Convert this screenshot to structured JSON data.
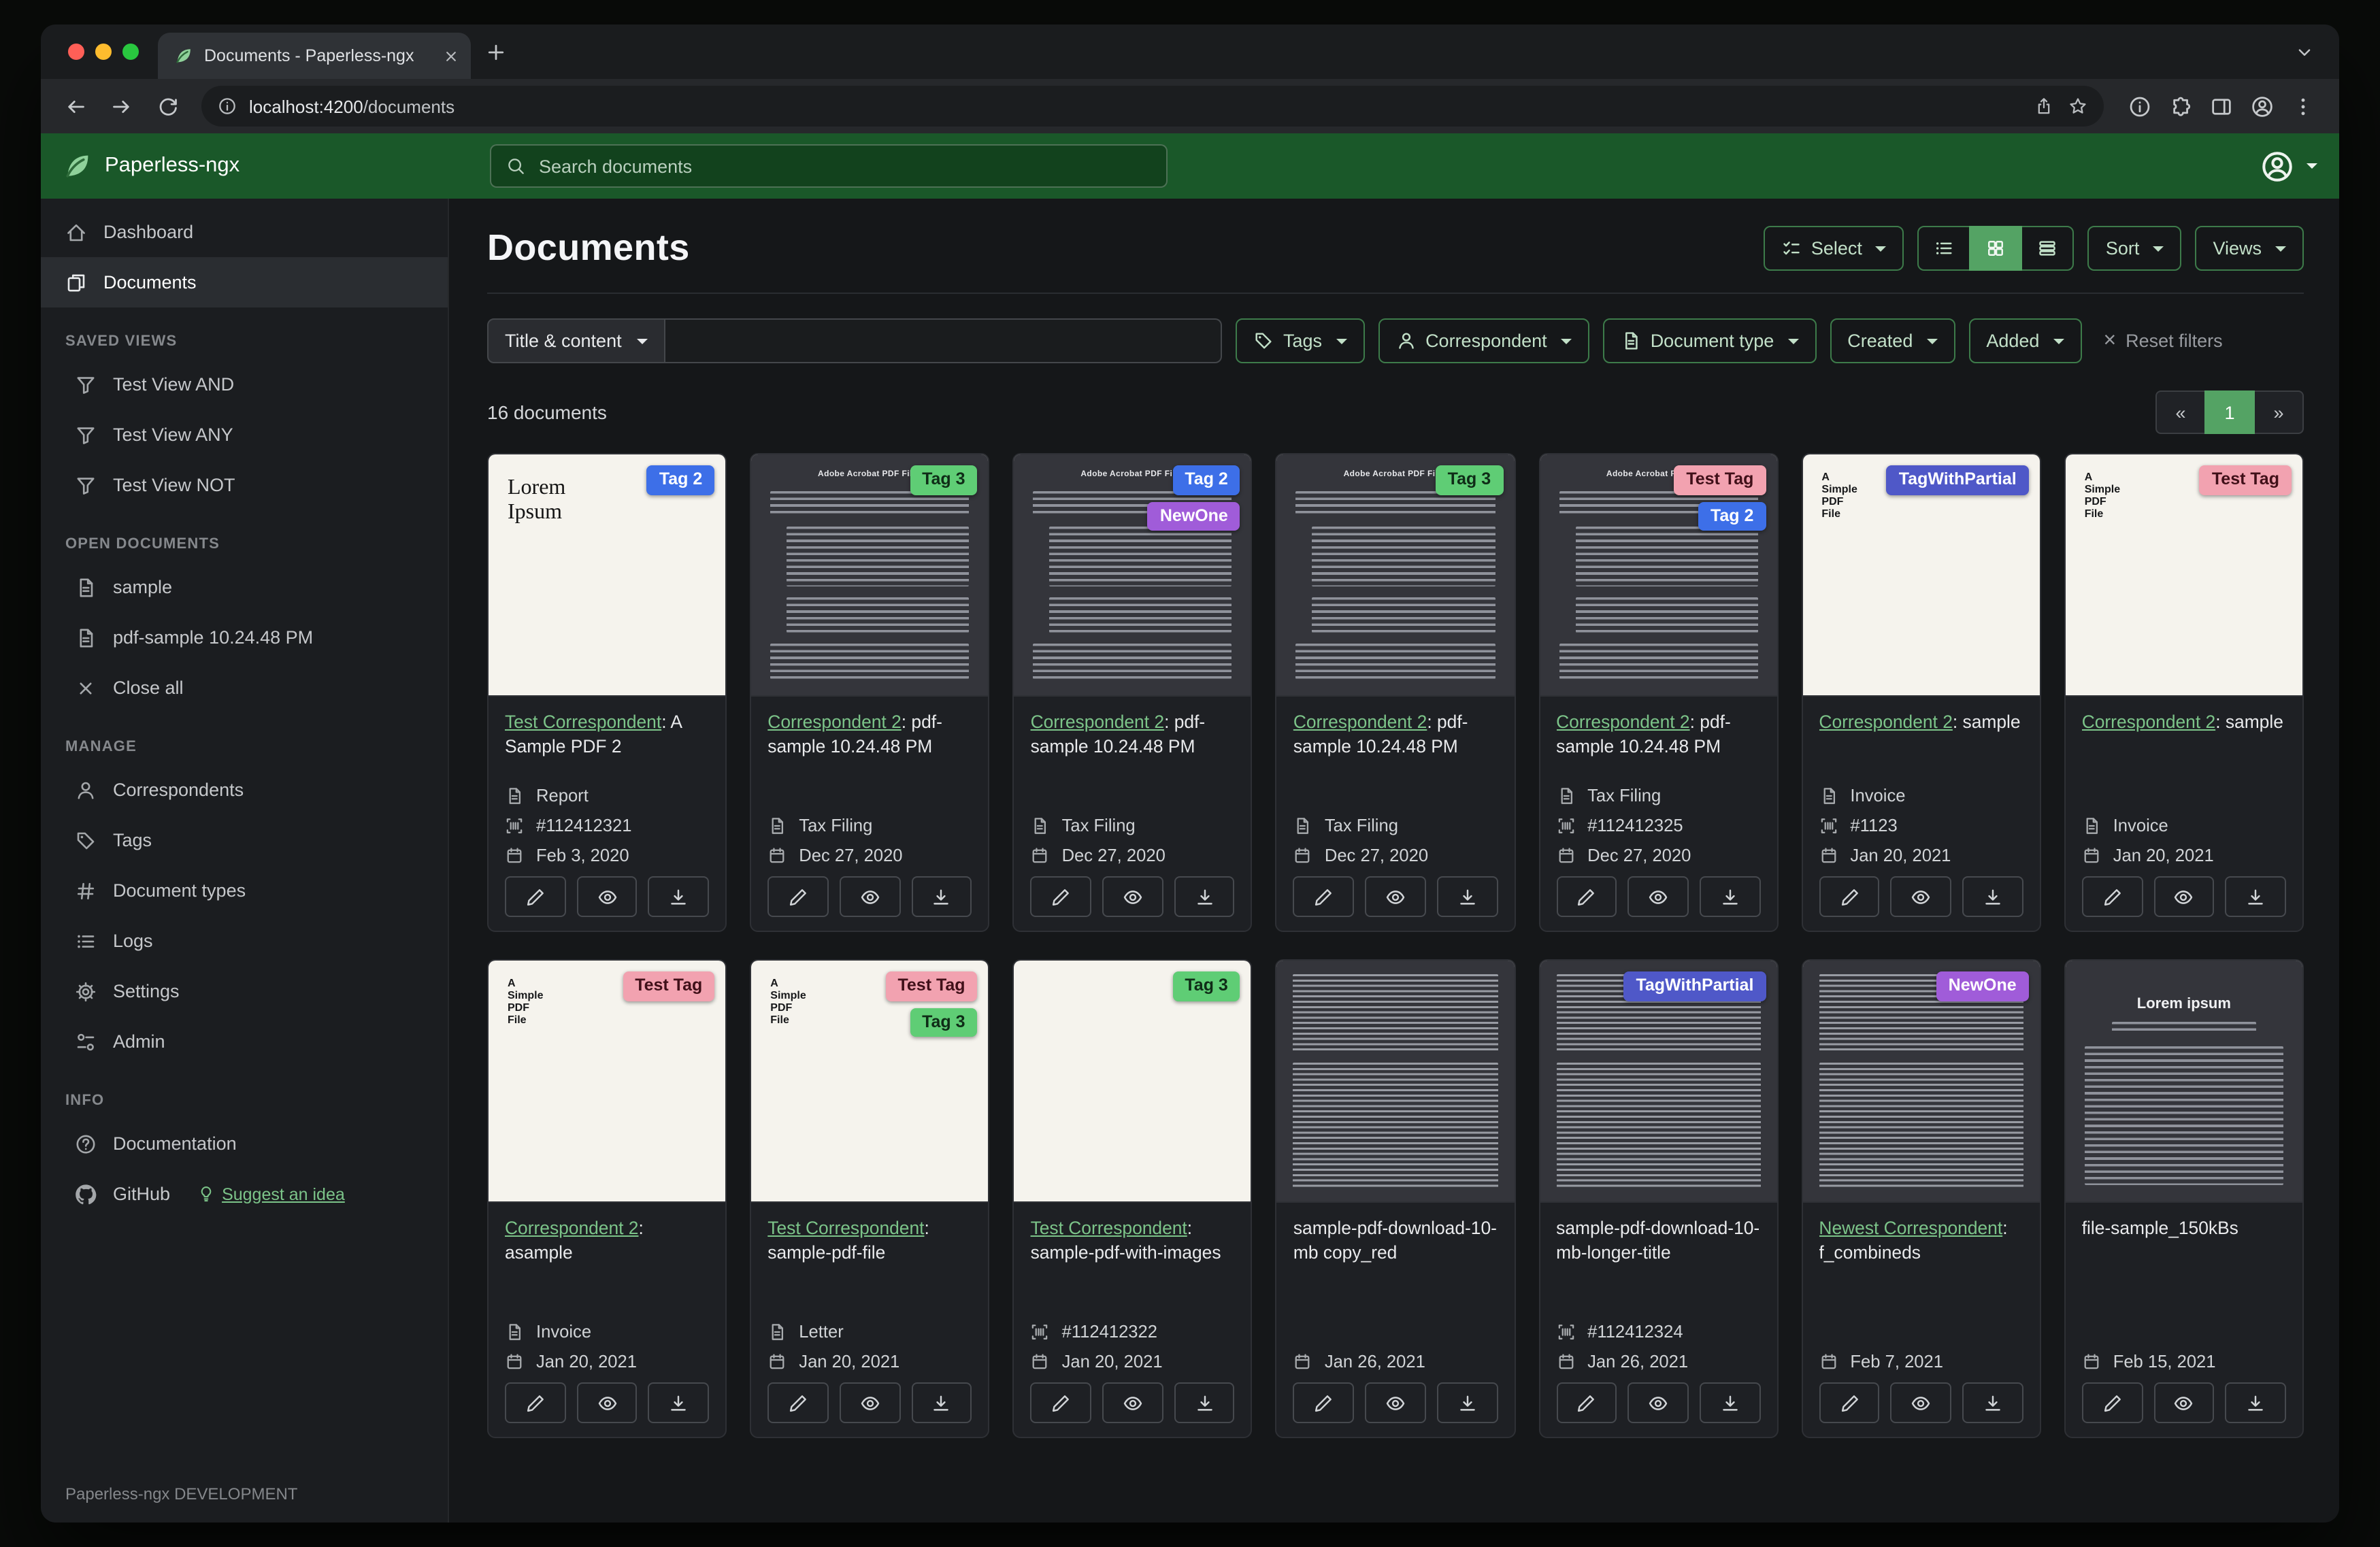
{
  "colors": {
    "header_green": "#1a5829",
    "accent_green": "#54a364",
    "link_green": "#7cc489"
  },
  "browser": {
    "tab_title": "Documents - Paperless-ngx",
    "url_host": "localhost:4200",
    "url_path": "/documents"
  },
  "header": {
    "brand": "Paperless-ngx",
    "search_placeholder": "Search documents"
  },
  "sidebar": {
    "primary": [
      {
        "label": "Dashboard",
        "icon": "house",
        "active": false
      },
      {
        "label": "Documents",
        "icon": "files",
        "active": true
      }
    ],
    "sections": [
      {
        "header": "SAVED VIEWS",
        "items": [
          {
            "label": "Test View AND",
            "icon": "funnel"
          },
          {
            "label": "Test View ANY",
            "icon": "funnel"
          },
          {
            "label": "Test View NOT",
            "icon": "funnel"
          }
        ]
      },
      {
        "header": "OPEN DOCUMENTS",
        "items": [
          {
            "label": "sample",
            "icon": "filetext"
          },
          {
            "label": "pdf-sample 10.24.48 PM",
            "icon": "filetext"
          },
          {
            "label": "Close all",
            "icon": "x"
          }
        ]
      },
      {
        "header": "MANAGE",
        "items": [
          {
            "label": "Correspondents",
            "icon": "person"
          },
          {
            "label": "Tags",
            "icon": "tag"
          },
          {
            "label": "Document types",
            "icon": "hash"
          },
          {
            "label": "Logs",
            "icon": "listul"
          },
          {
            "label": "Settings",
            "icon": "gear"
          },
          {
            "label": "Admin",
            "icon": "toggles"
          }
        ]
      },
      {
        "header": "INFO",
        "items": [
          {
            "label": "Documentation",
            "icon": "question"
          }
        ]
      }
    ],
    "github": {
      "label": "GitHub"
    },
    "suggest_idea": "Suggest an idea",
    "footer": "Paperless-ngx DEVELOPMENT"
  },
  "page": {
    "title": "Documents",
    "select_button": "Select",
    "sort_button": "Sort",
    "views_button": "Views",
    "view_modes": [
      "list",
      "grid",
      "details"
    ],
    "active_view_mode": "grid",
    "filter_dropdown": "Title & content",
    "filters": [
      {
        "label": "Tags",
        "icon": "tag"
      },
      {
        "label": "Correspondent",
        "icon": "person"
      },
      {
        "label": "Document type",
        "icon": "filetext"
      },
      {
        "label": "Created",
        "icon": null
      },
      {
        "label": "Added",
        "icon": null
      }
    ],
    "reset_filters": "Reset filters",
    "count": "16 documents",
    "pagination": {
      "prev": "«",
      "current": "1",
      "next": "»"
    }
  },
  "tag_styles": {
    "Tag 2": {
      "bg": "#3d6fe8",
      "fg": "#ffffff"
    },
    "Tag 3": {
      "bg": "#5fcd75",
      "fg": "#0f2c17"
    },
    "Test Tag": {
      "bg": "#f2a2b0",
      "fg": "#401019"
    },
    "NewOne": {
      "bg": "#a05cd9",
      "fg": "#ffffff"
    },
    "TagWithPartial": {
      "bg": "#4f58c8",
      "fg": "#ffffff"
    }
  },
  "cards": [
    {
      "thumb": "lorem",
      "thumb_title": "Lorem Ipsum",
      "tags": [
        "Tag 2"
      ],
      "link": "Test Correspondent",
      "title": ": A Sample PDF 2",
      "doc_type": "Report",
      "asn": "#112412321",
      "date": "Feb 3, 2020"
    },
    {
      "thumb": "darkdoc",
      "thumb_title": "Adobe Acrobat PDF Files",
      "tags": [
        "Tag 3"
      ],
      "link": "Correspondent 2",
      "title": ": pdf-sample 10.24.48 PM",
      "doc_type": "Tax Filing",
      "asn": null,
      "date": "Dec 27, 2020"
    },
    {
      "thumb": "darkdoc",
      "thumb_title": "Adobe Acrobat PDF Files",
      "tags": [
        "Tag 2",
        "NewOne"
      ],
      "link": "Correspondent 2",
      "title": ": pdf-sample 10.24.48 PM",
      "doc_type": "Tax Filing",
      "asn": null,
      "date": "Dec 27, 2020"
    },
    {
      "thumb": "darkdoc",
      "thumb_title": "Adobe Acrobat PDF Files",
      "tags": [
        "Tag 3"
      ],
      "link": "Correspondent 2",
      "title": ": pdf-sample 10.24.48 PM",
      "doc_type": "Tax Filing",
      "asn": null,
      "date": "Dec 27, 2020"
    },
    {
      "thumb": "darkdoc",
      "thumb_title": "Adobe Acrobat PDF Files",
      "tags": [
        "Test Tag",
        "Tag 2"
      ],
      "link": "Correspondent 2",
      "title": ": pdf-sample 10.24.48 PM",
      "doc_type": "Tax Filing",
      "asn": "#112412325",
      "date": "Dec 27, 2020"
    },
    {
      "thumb": "simple",
      "thumb_title": "A Simple PDF File",
      "tags": [
        "TagWithPartial"
      ],
      "link": "Correspondent 2",
      "title": ": sample",
      "doc_type": "Invoice",
      "asn": "#1123",
      "date": "Jan 20, 2021"
    },
    {
      "thumb": "simple",
      "thumb_title": "A Simple PDF File",
      "tags": [
        "Test Tag"
      ],
      "link": "Correspondent 2",
      "title": ": sample",
      "doc_type": "Invoice",
      "asn": null,
      "date": "Jan 20, 2021"
    },
    {
      "thumb": "simple",
      "thumb_title": "A Simple PDF File",
      "tags": [
        "Test Tag"
      ],
      "link": "Correspondent 2",
      "title": ": asample",
      "doc_type": "Invoice",
      "asn": null,
      "date": "Jan 20, 2021"
    },
    {
      "thumb": "simple",
      "thumb_title": "A Simple PDF File",
      "tags": [
        "Test Tag",
        "Tag 3"
      ],
      "link": "Test Correspondent",
      "title": ": sample-pdf-file",
      "doc_type": "Letter",
      "asn": null,
      "date": "Jan 20, 2021"
    },
    {
      "thumb": "map",
      "thumb_title": null,
      "tags": [
        "Tag 3"
      ],
      "link": "Test Correspondent",
      "title": ": sample-pdf-with-images",
      "doc_type": null,
      "asn": "#112412322",
      "date": "Jan 20, 2021"
    },
    {
      "thumb": "darkdense",
      "thumb_title": null,
      "tags": [],
      "link": null,
      "title": "sample-pdf-download-10-mb copy_red",
      "doc_type": null,
      "asn": null,
      "date": "Jan 26, 2021"
    },
    {
      "thumb": "darkdense",
      "thumb_title": null,
      "tags": [
        "TagWithPartial"
      ],
      "link": null,
      "title": "sample-pdf-download-10-mb-longer-title",
      "doc_type": null,
      "asn": "#112412324",
      "date": "Jan 26, 2021"
    },
    {
      "thumb": "darkdense",
      "thumb_title": null,
      "tags": [
        "NewOne"
      ],
      "link": "Newest Correspondent",
      "title": ": f_combineds",
      "doc_type": null,
      "asn": null,
      "date": "Feb 7, 2021"
    },
    {
      "thumb": "darkcenter",
      "thumb_title": "Lorem ipsum",
      "tags": [],
      "link": null,
      "title": "file-sample_150kBs",
      "doc_type": null,
      "asn": null,
      "date": "Feb 15, 2021"
    }
  ]
}
